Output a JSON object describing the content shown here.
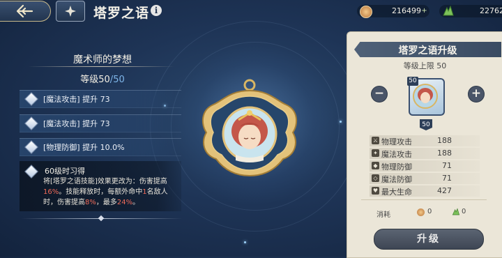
{
  "header": {
    "title": "塔罗之语",
    "info_icon": "i"
  },
  "currency": {
    "gold": "216499",
    "green": "22762",
    "plus": "+"
  },
  "left": {
    "subtitle": "魔术师的梦想",
    "level_label": "等级50",
    "level_sep": "/",
    "level_max": "50",
    "stats": [
      {
        "text": "[魔法攻击] 提升 73"
      },
      {
        "text": "[魔法攻击] 提升 73"
      },
      {
        "text": "[物理防御] 提升 10.0%"
      }
    ],
    "skill": {
      "heading": "60级时习得",
      "desc_parts": [
        "将[塔罗之语技能]效果更改为：伤害提高",
        "16%",
        "。技能释放时，每额外命中",
        "1",
        "名敌人时，伤害提高",
        "8%",
        "，最多",
        "24%",
        "。"
      ]
    }
  },
  "panel": {
    "title": "塔罗之语升级",
    "level_cap": "等级上限 50",
    "minus": "−",
    "plus": "+",
    "item_level": "50",
    "stats": [
      {
        "label": "物理攻击",
        "value": "188",
        "icon": "sword-icon"
      },
      {
        "label": "魔法攻击",
        "value": "188",
        "icon": "wand-icon"
      },
      {
        "label": "物理防御",
        "value": "71",
        "icon": "shield-icon"
      },
      {
        "label": "魔法防御",
        "value": "71",
        "icon": "magic-shield-icon"
      },
      {
        "label": "最大生命",
        "value": "427",
        "icon": "heart-icon"
      }
    ],
    "cost_label": "消耗",
    "cost_gold": "0",
    "cost_green": "0",
    "upgrade_button": "升级"
  }
}
